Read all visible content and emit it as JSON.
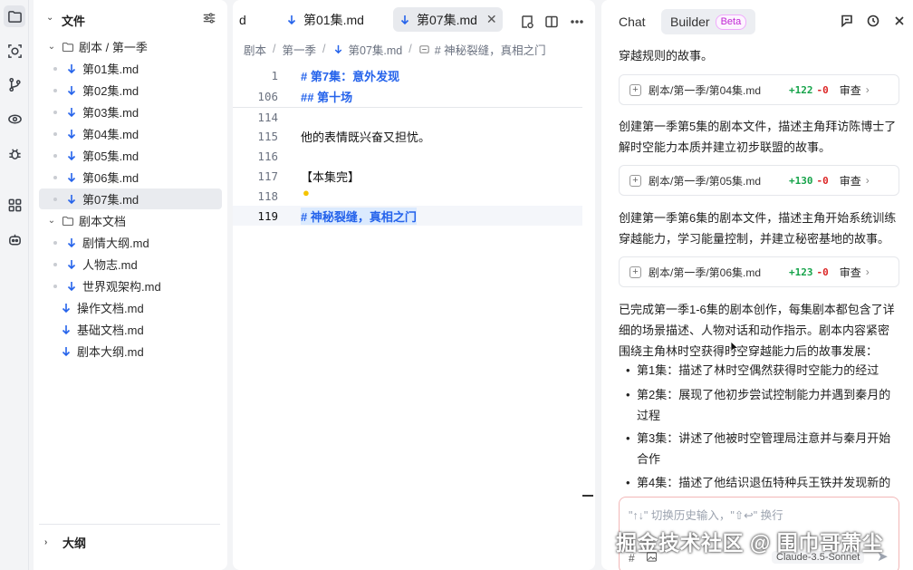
{
  "explorer": {
    "title": "文件",
    "tree": [
      {
        "kind": "folder",
        "label": "剧本 / 第一季",
        "depth": 0
      },
      {
        "kind": "file",
        "label": "第01集.md",
        "depth": 1
      },
      {
        "kind": "file",
        "label": "第02集.md",
        "depth": 1
      },
      {
        "kind": "file",
        "label": "第03集.md",
        "depth": 1
      },
      {
        "kind": "file",
        "label": "第04集.md",
        "depth": 1
      },
      {
        "kind": "file",
        "label": "第05集.md",
        "depth": 1
      },
      {
        "kind": "file",
        "label": "第06集.md",
        "depth": 1
      },
      {
        "kind": "file",
        "label": "第07集.md",
        "depth": 1,
        "selected": true
      },
      {
        "kind": "folder",
        "label": "剧本文档",
        "depth": 0
      },
      {
        "kind": "file",
        "label": "剧情大纲.md",
        "depth": 1
      },
      {
        "kind": "file",
        "label": "人物志.md",
        "depth": 1
      },
      {
        "kind": "file",
        "label": "世界观架构.md",
        "depth": 1
      },
      {
        "kind": "file",
        "label": "操作文档.md",
        "depth": 0
      },
      {
        "kind": "file",
        "label": "基础文档.md",
        "depth": 0
      },
      {
        "kind": "file",
        "label": "剧本大纲.md",
        "depth": 0
      }
    ],
    "outline_label": "大纲"
  },
  "editor": {
    "tabs": [
      {
        "label": "d"
      },
      {
        "label": "第01集.md"
      },
      {
        "label": "第07集.md",
        "active": true,
        "close": "✕"
      }
    ],
    "breadcrumb": [
      "剧本",
      "第一季",
      "第07集.md",
      "# 神秘裂缝，真相之门"
    ],
    "lines": [
      {
        "no": "1",
        "text": "# 第7集：意外发现",
        "heading": true
      },
      {
        "no": "106",
        "text": "## 第十场",
        "heading": true
      },
      {
        "no": "114",
        "text": ""
      },
      {
        "no": "115",
        "text": "他的表情既兴奋又担忧。"
      },
      {
        "no": "116",
        "text": ""
      },
      {
        "no": "117",
        "text": "【本集完】"
      },
      {
        "no": "118",
        "text": ""
      },
      {
        "no": "119",
        "text": "# 神秘裂缝，真相之门",
        "heading": true,
        "current": true
      }
    ]
  },
  "chat": {
    "tab_chat": "Chat",
    "tab_builder": "Builder",
    "beta": "Beta",
    "msg_top": "穿越规则的故事。",
    "card1": {
      "path": "剧本/第一季/第04集.md",
      "add": "+122",
      "del": "-0",
      "review": "审查"
    },
    "msg2": "创建第一季第5集的剧本文件，描述主角拜访陈博士了解时空能力本质并建立初步联盟的故事。",
    "card2": {
      "path": "剧本/第一季/第05集.md",
      "add": "+130",
      "del": "-0",
      "review": "审查"
    },
    "msg3": "创建第一季第6集的剧本文件，描述主角开始系统训练穿越能力，学习能量控制，并建立秘密基地的故事。",
    "card3": {
      "path": "剧本/第一季/第06集.md",
      "add": "+123",
      "del": "-0",
      "review": "审查"
    },
    "summary": "已完成第一季1-6集的剧本创作，每集剧本都包含了详细的场景描述、人物对话和动作指示。剧本内容紧密围绕主角林时空获得时空穿越能力后的故事发展：",
    "bullets": [
      "第1集：描述了林时空偶然获得时空能力的经过",
      "第2集：展现了他初步尝试控制能力并遇到秦月的过程",
      "第3集：讲述了他被时空管理局注意并与秦月开始合作",
      "第4集：描述了他结识退伍特种兵王铁并发现新的"
    ],
    "input_placeholder": "\"↑↓\" 切换历史输入，\"⇧↩\" 换行",
    "tool_hash": "#",
    "model": "Claude-3.5-Sonnet"
  },
  "watermark": "掘金技术社区 @ 围巾哥萧尘"
}
